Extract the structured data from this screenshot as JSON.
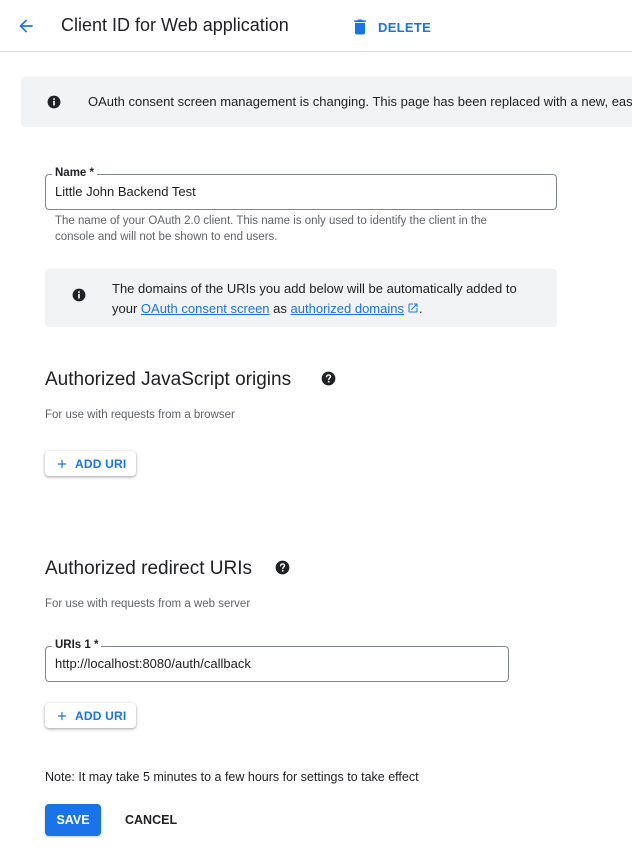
{
  "header": {
    "title": "Client ID for Web application",
    "delete_label": "DELETE"
  },
  "banner": {
    "text": "OAuth consent screen management is changing. This page has been replaced with a new, easier"
  },
  "name_field": {
    "label": "Name *",
    "value": "Little John Backend Test",
    "hint_line1": "The name of your OAuth 2.0 client. This name is only used to identify the client in the",
    "hint_line2": "console and will not be shown to end users."
  },
  "domains_info": {
    "line1": "The domains of the URIs you add below will be automatically added to",
    "prefix": "your ",
    "consent_link": "OAuth consent screen",
    "middle": " as ",
    "domains_link": "authorized domains",
    "suffix": "."
  },
  "js_origins": {
    "title": "Authorized JavaScript origins",
    "description": "For use with requests from a browser",
    "add_label": "ADD URI"
  },
  "redirect_uris": {
    "title": "Authorized redirect URIs",
    "description": "For use with requests from a web server",
    "field_label": "URIs 1 *",
    "field_value": "http://localhost:8080/auth/callback",
    "add_label": "ADD URI"
  },
  "note": "Note: It may take 5 minutes to a few hours for settings to take effect",
  "actions": {
    "save_label": "SAVE",
    "cancel_label": "CANCEL"
  },
  "colors": {
    "accent": "#1a73e8",
    "banner_bg": "#f1f3f4",
    "text": "#202124",
    "muted": "#5f6368"
  },
  "icons": [
    "arrow-back-icon",
    "trash-icon",
    "info-icon",
    "help-icon",
    "plus-icon",
    "external-link-icon"
  ]
}
